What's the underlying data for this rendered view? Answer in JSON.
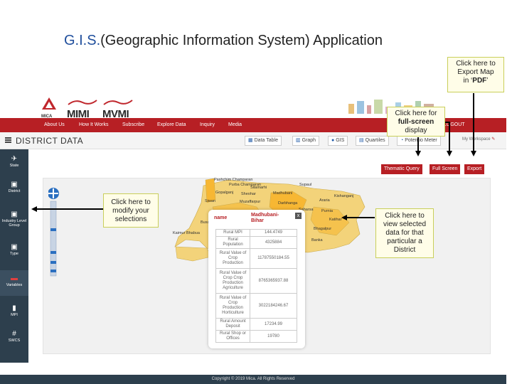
{
  "slide": {
    "title_gis": "G.I.S.",
    "title_rest": "(Geographic Information System) Application"
  },
  "callouts": {
    "export_pdf": {
      "line1": "Click here to",
      "line2": "Export Map",
      "line3": "in ‘",
      "bold": "PDF",
      "line3_end": "’"
    },
    "fullscreen": {
      "line1": "Click  here for",
      "bold": "full-screen",
      "line3": "display"
    },
    "modify": {
      "line1": "Click here to",
      "line2": "modify your",
      "line3": "selections"
    },
    "view_data": {
      "line1": "Click  here to",
      "line2": "view selected",
      "line3": "data for that",
      "line4": "particular a",
      "line5": "District"
    }
  },
  "app": {
    "logos": [
      "MICA",
      "MIMI",
      "MVMI"
    ],
    "nav": [
      "About Us",
      "How It Works",
      "Subscribe",
      "Explore Data",
      "Inquiry",
      "Media"
    ],
    "logout": "LOGOUT",
    "page_title": "DISTRICT DATA",
    "tabs": [
      {
        "label": "Data Table",
        "icon": "table-icon"
      },
      {
        "label": "Graph",
        "icon": "graph-icon"
      },
      {
        "label": "GIS",
        "icon": "map-pin-icon"
      },
      {
        "label": "Quartiles",
        "icon": "grid-icon"
      },
      {
        "label": "Potentio Meter",
        "icon": "meter-icon"
      }
    ],
    "workspace": "My Workspace",
    "map_buttons": [
      "Thematic Query",
      "Full Screen",
      "Export"
    ],
    "sidebar": [
      {
        "label": "State",
        "icon": "plane-icon"
      },
      {
        "label": "District",
        "icon": "image-icon"
      },
      {
        "label": "Industry Level Group",
        "icon": "image-icon"
      },
      {
        "label": "Type",
        "icon": "image-icon"
      },
      {
        "label": "Variables",
        "icon": "variables-icon"
      },
      {
        "label": "MPI",
        "icon": "bar-chart-icon"
      },
      {
        "label": "SWCS",
        "icon": "hash-icon"
      }
    ],
    "map_labels": [
      "Purba Champaran",
      "Sitamarhi",
      "Madhubani",
      "Supaul",
      "Araria",
      "Kishanganj",
      "Gopalganj",
      "Siwan",
      "Muzaffarpur",
      "Darbhanga",
      "Purnia",
      "Katihar",
      "Bhagalpur",
      "Banka",
      "Kaimur Bhabua",
      "Buxar",
      "Pashchim Champaran",
      "Sheohar",
      "Saharsa"
    ],
    "popup": {
      "name_label": "name",
      "name_value": "Madhubani- Bihar",
      "close": "x",
      "rows": [
        {
          "k": "Rural MPI",
          "v": "144.4749"
        },
        {
          "k": "Rural Population",
          "v": "4325884"
        },
        {
          "k": "Rural Value of Crop Production",
          "v": "11787550184.55"
        },
        {
          "k": "Rural Value of Crop Crop Production Agriculture",
          "v": "8765365937.88"
        },
        {
          "k": "Rural Value of Crop Production Horticulture",
          "v": "3022184246.67"
        },
        {
          "k": "Rural Amount Deposit",
          "v": "17234.99"
        },
        {
          "k": "Rural Shop or Offices",
          "v": "19780"
        }
      ]
    },
    "footer": "Copyright © 2019 Mica. All Rights Reserved"
  }
}
